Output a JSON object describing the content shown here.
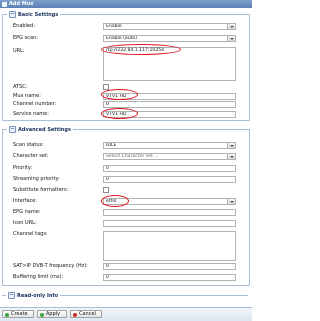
{
  "window": {
    "title": "Add Mux"
  },
  "basic": {
    "title": "Basic Settings",
    "enabled_label": "Enabled:",
    "enabled_value": "Enable",
    "epg_scan_label": "EPG scan:",
    "epg_scan_value": "Enable (auto)",
    "url_label": "URL:",
    "url_value": "rtp://232.84.1.117:10254",
    "atsc_label": "ATSC:",
    "mux_name_label": "Mux name:",
    "mux_name_value": "VTV1 HD",
    "channel_number_label": "Channel number:",
    "channel_number_value": "0",
    "service_name_label": "Service name:",
    "service_name_value": "VTV1 HD"
  },
  "advanced": {
    "title": "Advanced Settings",
    "scan_status_label": "Scan status:",
    "scan_status_value": "IDLE",
    "charset_label": "Character set:",
    "charset_placeholder": "Select Character set ...",
    "priority_label": "Priority:",
    "priority_value": "0",
    "streaming_priority_label": "Streaming priority:",
    "streaming_priority_value": "0",
    "substitute_label": "Substitute formatters:",
    "interface_label": "Interface:",
    "interface_value": "eth0",
    "epg_name_label": "EPG name:",
    "icon_url_label": "Icon URL:",
    "channel_tags_label": "Channel tags:",
    "satip_label": "SAT>IP DVB-T frequency (Hz):",
    "satip_value": "0",
    "buffering_label": "Buffering limit (ms):",
    "buffering_value": "0"
  },
  "readonly": {
    "title": "Read-only Info"
  },
  "toolbar": {
    "create_label": "Create",
    "apply_label": "Apply",
    "cancel_label": "Cancel"
  },
  "colors": {
    "highlight": "#e0141e",
    "header": "#5b80b4",
    "border": "#a7bcd8"
  },
  "icons": {
    "collapse": "minus-icon",
    "expand": "plus-icon",
    "create": "add-icon",
    "apply": "check-icon",
    "cancel": "cancel-icon"
  }
}
